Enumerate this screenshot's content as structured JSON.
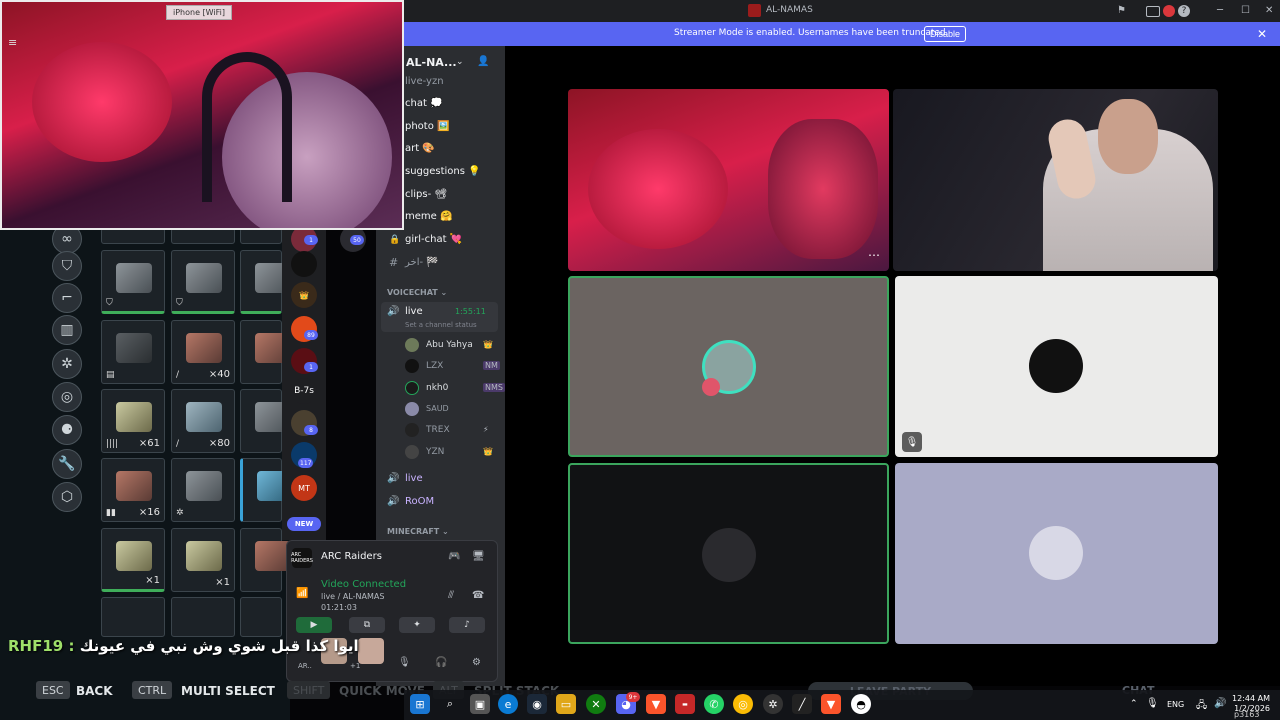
{
  "camera_window": {
    "label": "iPhone [WiFi]"
  },
  "window": {
    "title": "AL-NAMAS"
  },
  "banner": {
    "text": "Streamer Mode is enabled. Usernames have been truncated.",
    "button": "Disable"
  },
  "server": {
    "name": "AL-NA..."
  },
  "channels": [
    {
      "label": "live-yzn"
    },
    {
      "label": "chat 💭"
    },
    {
      "label": "photo 🖼️"
    },
    {
      "label": "art 🎨"
    },
    {
      "label": "suggestions 💡"
    },
    {
      "label": "clips- 📽"
    },
    {
      "label": "meme 🤗"
    },
    {
      "label": "girl-chat 💘"
    },
    {
      "label": "اخر- 🏁"
    }
  ],
  "voice_category": "VOICECHAT ⌄",
  "live_channel": {
    "name": "live",
    "timer": "1:55:11",
    "status": "Set a channel status"
  },
  "voice_users": [
    {
      "name": "Abu Yahya",
      "badge": "👑"
    },
    {
      "name": "LZX",
      "badge": "NM"
    },
    {
      "name": "nkh0",
      "badge": "NMS"
    },
    {
      "name": "SAUD",
      "badge": ""
    },
    {
      "name": "TREX",
      "badge": "⚡"
    },
    {
      "name": "YZN",
      "badge": "👑"
    }
  ],
  "more_channels": [
    {
      "label": "live"
    },
    {
      "label": "RoOM"
    }
  ],
  "minecraft_category": "MINECRAFT ⌄",
  "guild_labels": {
    "b7": "B-7s",
    "mt": "MT",
    "new": "NEW",
    "badge_50": "50",
    "badge_1": "1",
    "badge_89": "89",
    "badge_8": "8",
    "badge_117": "117"
  },
  "panel": {
    "activity": "ARC Raiders",
    "activity_abbr": "ARC RAIDERS",
    "voice_status": "Video Connected",
    "voice_channel": "live / AL-NAMAS",
    "voice_time": "01:21:03",
    "user_short": "AR..",
    "user_extra": "+1"
  },
  "game": {
    "chat_user": "RHF19 :",
    "chat_text": "ايوا كذا قبل شوي وش نبي في عيونك",
    "keys": [
      {
        "key": "ESC",
        "label": "BACK"
      },
      {
        "key": "CTRL",
        "label": "MULTI SELECT"
      },
      {
        "key": "SHIFT",
        "label": "QUICK MOVE"
      },
      {
        "key": "ALT",
        "label": "SPLIT STACK"
      }
    ],
    "leave": "LEAVE PARTY",
    "chat": "CHAT",
    "slot_counts": [
      "×40",
      "×61",
      "×80",
      "×16",
      "×1",
      "×1"
    ]
  },
  "taskbar": {
    "lang": "ENG",
    "time": "12:44 AM",
    "date": "1/2/2026",
    "watermark": "p3163",
    "notif_badge": "9+"
  },
  "colors": {
    "blurple": "#5865f2",
    "speaking": "#3ba55d",
    "connected": "#23a55a"
  }
}
